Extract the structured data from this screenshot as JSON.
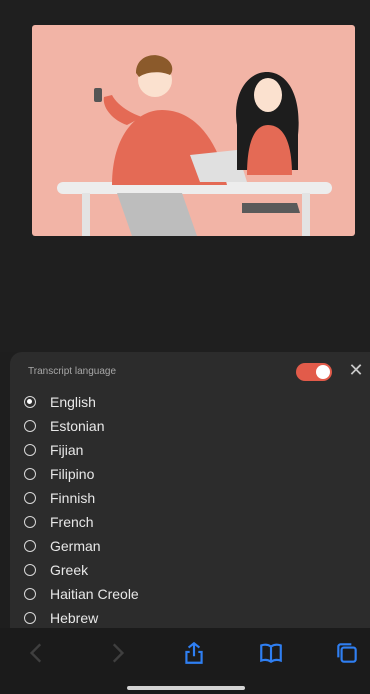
{
  "transcript": {
    "header": "Transcript language",
    "languages": [
      {
        "label": "English",
        "selected": true
      },
      {
        "label": "Estonian",
        "selected": false
      },
      {
        "label": "Fijian",
        "selected": false
      },
      {
        "label": "Filipino",
        "selected": false
      },
      {
        "label": "Finnish",
        "selected": false
      },
      {
        "label": "French",
        "selected": false
      },
      {
        "label": "German",
        "selected": false
      },
      {
        "label": "Greek",
        "selected": false
      },
      {
        "label": "Haitian Creole",
        "selected": false
      },
      {
        "label": "Hebrew",
        "selected": false
      }
    ]
  },
  "toolbar": {
    "icons": [
      "back-icon",
      "forward-icon",
      "share-icon",
      "bookmarks-icon",
      "tabs-icon"
    ]
  },
  "colors": {
    "accent": "#e25b4a",
    "illustration_bg": "#f2b4a6",
    "toolbar_blue": "#2f7ff2"
  }
}
